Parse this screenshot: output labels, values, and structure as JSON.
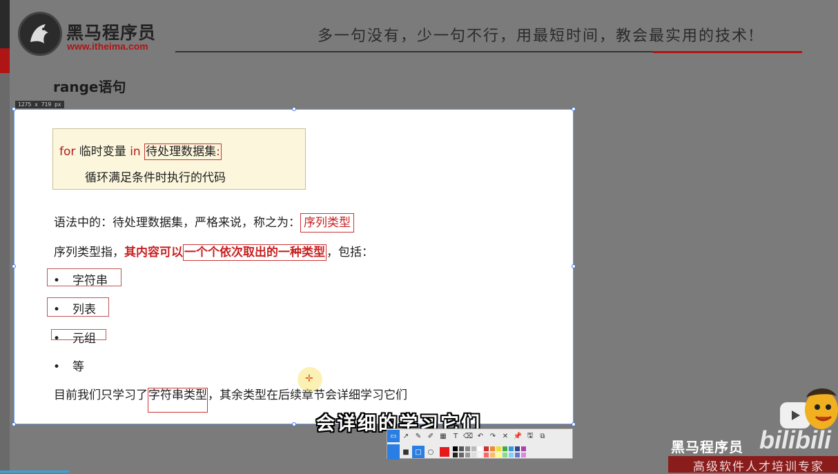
{
  "header": {
    "brand_name": "黑马程序员",
    "brand_url": "www.itheima.com",
    "slogan": "多一句没有，少一句不行，用最短时间，教会最实用的技术!"
  },
  "section_title": "range语句",
  "size_tag": "1275 x 719 px",
  "slide": {
    "code": {
      "kw_for": "for",
      "var": " 临时变量 ",
      "kw_in": "in",
      "dataset": "待处理数据集",
      "colon": ":",
      "body": "循环满足条件时执行的代码"
    },
    "p1_prefix": "语法中的：待处理数据集，严格来说，称之为：",
    "p1_highlight": "序列类型",
    "p2_prefix": "序列类型指，",
    "p2_bold1": "其内容可以",
    "p2_bold2": "一个个依次取出的一种类型",
    "p2_suffix": "，包括：",
    "bullets": [
      "字符串",
      "列表",
      "元组",
      "等"
    ],
    "bullet_symbol": "•",
    "p3_prefix": "目前我们只学习了",
    "p3_boxed": "字符串类型",
    "p3_suffix": "，其余类型在后续章节会详细学习它们"
  },
  "subtitle": "会详细的学习它们",
  "toolbar": {
    "tools_row1": [
      "▭",
      "↗",
      "✎",
      "✐",
      "▦",
      "T",
      "⌫",
      "↶",
      "↷",
      "✕",
      "📌",
      "🖫",
      "⧉"
    ],
    "tools_row2": [
      "■",
      "□",
      "○"
    ],
    "selected_color": "#e61a1a",
    "palette": [
      "#000000",
      "#555555",
      "#888888",
      "#bbbbbb",
      "#ffffff",
      "#cc3333",
      "#ee8833",
      "#eedd33",
      "#44aa44",
      "#3399dd",
      "#334488",
      "#aa44aa",
      "#222222",
      "#666666",
      "#999999",
      "#dddddd",
      "#f5f5f5",
      "#ff6666",
      "#ffbb66",
      "#ffff88",
      "#88dd88",
      "#88ccff",
      "#6677cc",
      "#dd88dd"
    ]
  },
  "watermark": {
    "brand": "黑马程序员",
    "platform": "bilibili",
    "slogan": "高级软件人才培训专家"
  },
  "colors": {
    "accent_red": "#b01515",
    "keyword_red": "#c81e1e",
    "slide_bg": "#ffffff",
    "frame_bg": "#7b7b7b"
  }
}
